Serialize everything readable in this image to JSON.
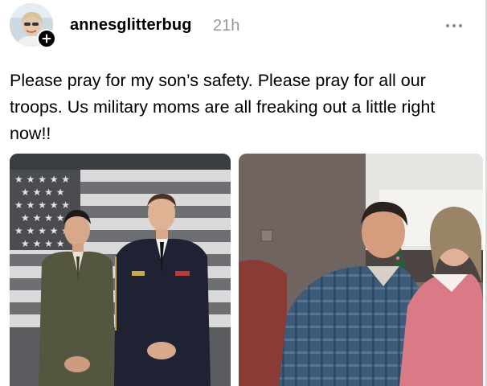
{
  "post": {
    "username": "annesglitterbug",
    "timestamp": "21h",
    "text": "Please pray for my son’s safety. Please pray for all our troops. Us military moms are all freaking out a little right now!!",
    "icons": {
      "avatar": "profile-photo",
      "follow": "plus-icon",
      "more": "more-dots-icon"
    },
    "images": [
      {
        "subject": "two-soldiers-in-dress-uniform-before-american-flag"
      },
      {
        "subject": "son-and-mother-at-home-with-christmas-tree"
      }
    ]
  }
}
